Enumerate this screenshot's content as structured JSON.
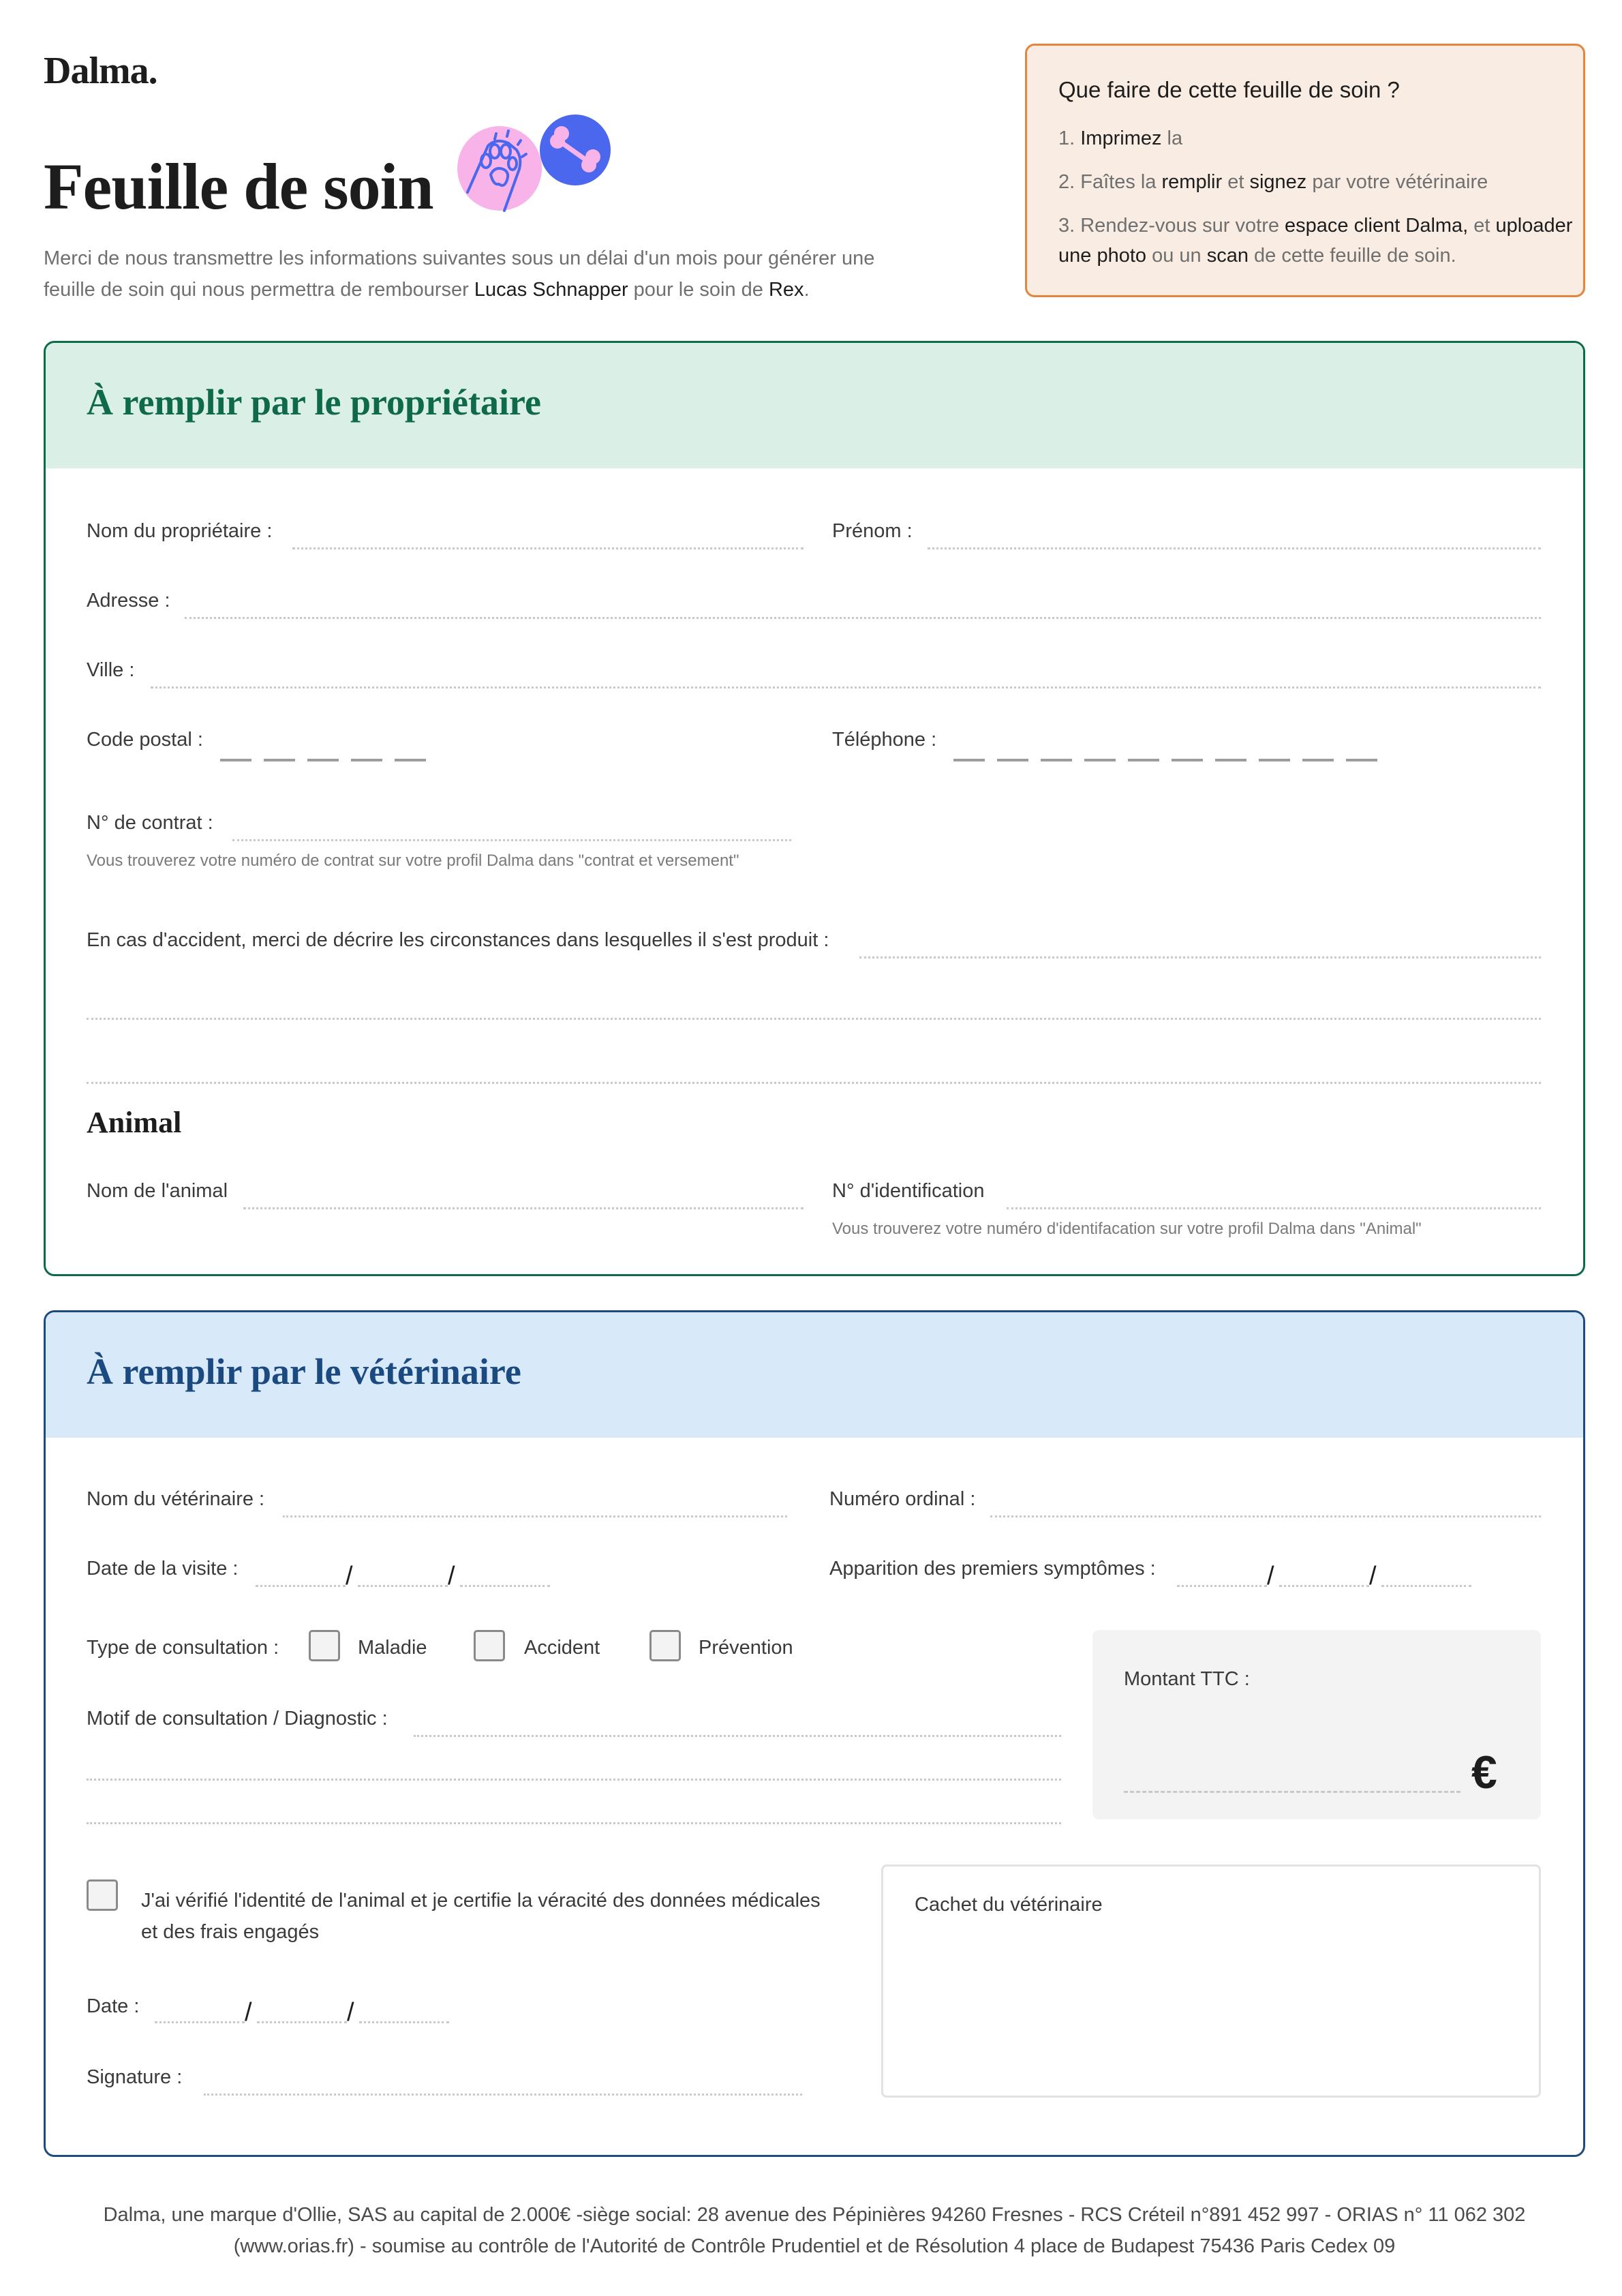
{
  "brand": {
    "logo": "Dalma."
  },
  "header": {
    "title": "Feuille de soin",
    "intro_part1": "Merci de nous transmettre les informations suivantes sous un délai d'un mois pour générer une feuille de soin qui nous permettra de rembourser ",
    "owner_name": "Lucas Schnapper",
    "intro_part2": " pour le soin de ",
    "pet_name": "Rex",
    "intro_end": "."
  },
  "illustration": {
    "left_icon": "paw-icon",
    "right_icon": "bone-icon",
    "colors": {
      "pink": "#f8b4e8",
      "blue": "#4a67ee"
    }
  },
  "instructions": {
    "heading": "Que faire de cette feuille de soin ?",
    "step1": {
      "num": "1. ",
      "b1": "Imprimez",
      "t1": " la"
    },
    "step2": {
      "num": "2. Faîtes la ",
      "b1": "remplir",
      "t1": " et ",
      "b2": "signez",
      "t2": " par votre vétérinaire"
    },
    "step3": {
      "num": "3. Rendez-vous sur votre ",
      "b1": "espace client Dalma,",
      "t1": " et ",
      "b2": "uploader une photo",
      "t2": " ou un ",
      "b3": "scan",
      "t3": " de cette feuille de soin."
    }
  },
  "owner_section": {
    "title": "À remplir par le propriétaire",
    "color": "#0e6a4a",
    "fields": {
      "last_name": "Nom du propriétaire :",
      "first_name": "Prénom :",
      "address": "Adresse :",
      "city": "Ville :",
      "postal_code": "Code postal :",
      "phone": "Téléphone :",
      "contract": "N° de contrat :",
      "contract_hint": "Vous trouverez votre numéro de contrat sur votre profil Dalma dans \"contrat et versement\"",
      "accident": "En cas d'accident, merci de décrire les circonstances dans lesquelles il s'est produit :"
    },
    "postal_code_digits": 5,
    "phone_digits": 10,
    "animal": {
      "heading": "Animal",
      "name": "Nom de l'animal",
      "id": "N° d'identification",
      "id_hint": "Vous trouverez votre numéro d'identifacation sur votre profil Dalma dans \"Animal\""
    }
  },
  "vet_section": {
    "title": "À remplir par le vétérinaire",
    "color": "#1a4a80",
    "fields": {
      "vet_name": "Nom du vétérinaire :",
      "ordinal": "Numéro ordinal :",
      "visit_date": "Date de la visite :",
      "symptoms": "Apparition des premiers symptômes :",
      "consult_type": "Type de consultation :",
      "motive": "Motif de consultation / Diagnostic :",
      "amount": "Montant TTC :",
      "currency": "€",
      "certify": "J'ai vérifié l'identité de l'animal et je certifie la véracité des données médicales et des frais engagés",
      "date": "Date :",
      "signature": "Signature :",
      "stamp": "Cachet du vétérinaire"
    },
    "consult_options": [
      {
        "label": "Maladie",
        "checked": false
      },
      {
        "label": "Accident",
        "checked": false
      },
      {
        "label": "Prévention",
        "checked": false
      }
    ],
    "certify_checked": false,
    "date_separator": "/"
  },
  "footer": {
    "line1": "Dalma, une marque d'Ollie, SAS au capital de 2.000€ -siège social: 28 avenue des Pépinières 94260 Fresnes - RCS Créteil n°891 452 997 - ORIAS n° 11 062 302",
    "line2": "(www.orias.fr) - soumise au contrôle de l'Autorité de Contrôle Prudentiel et de Résolution 4 place de Budapest 75436 Paris Cedex 09"
  }
}
